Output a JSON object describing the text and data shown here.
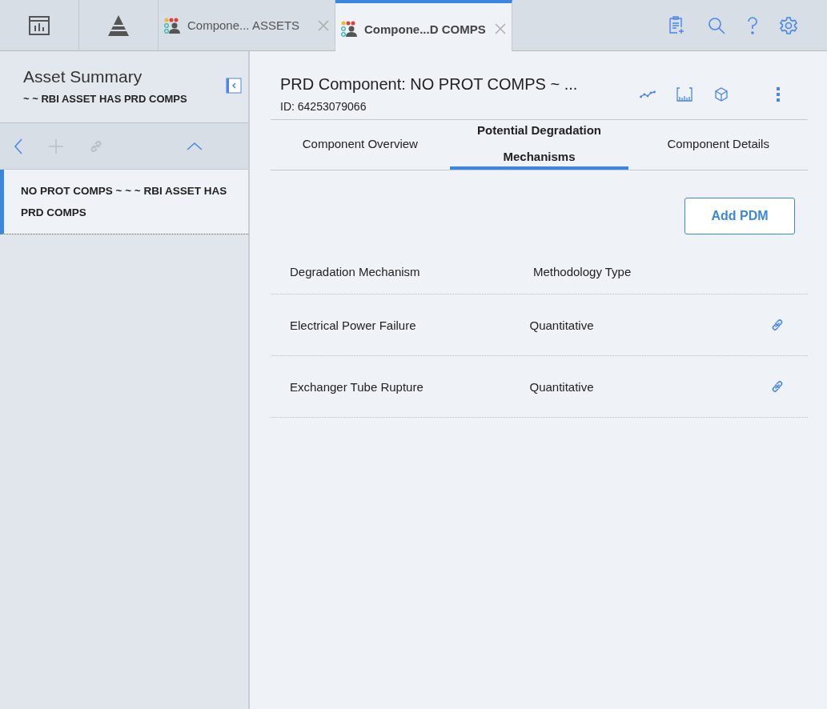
{
  "top_bar": {
    "tabs": [
      {
        "label": "Compone... ASSETS",
        "selected": false
      },
      {
        "label": "Compone...D COMPS",
        "selected": true
      }
    ]
  },
  "sidebar": {
    "title": "Asset Summary",
    "subtitle": "~ ~ RBI ASSET HAS PRD COMPS",
    "items": [
      {
        "label": "NO PROT COMPS ~ ~ ~ RBI ASSET HAS PRD COMPS",
        "selected": true
      }
    ]
  },
  "record": {
    "title": "PRD Component: NO PROT COMPS ~ ...",
    "id": "ID: 64253079066"
  },
  "tabs": [
    {
      "label": "Component Overview",
      "selected": false
    },
    {
      "label": "Potential Degradation Mechanisms",
      "selected": true
    },
    {
      "label": "Component Details",
      "selected": false
    }
  ],
  "add_button": "Add PDM",
  "table": {
    "columns": [
      "Degradation Mechanism",
      "Methodology Type"
    ],
    "rows": [
      [
        "Electrical Power Failure",
        "Quantitative"
      ],
      [
        "Exchanger Tube Rupture",
        "Quantitative"
      ]
    ]
  }
}
